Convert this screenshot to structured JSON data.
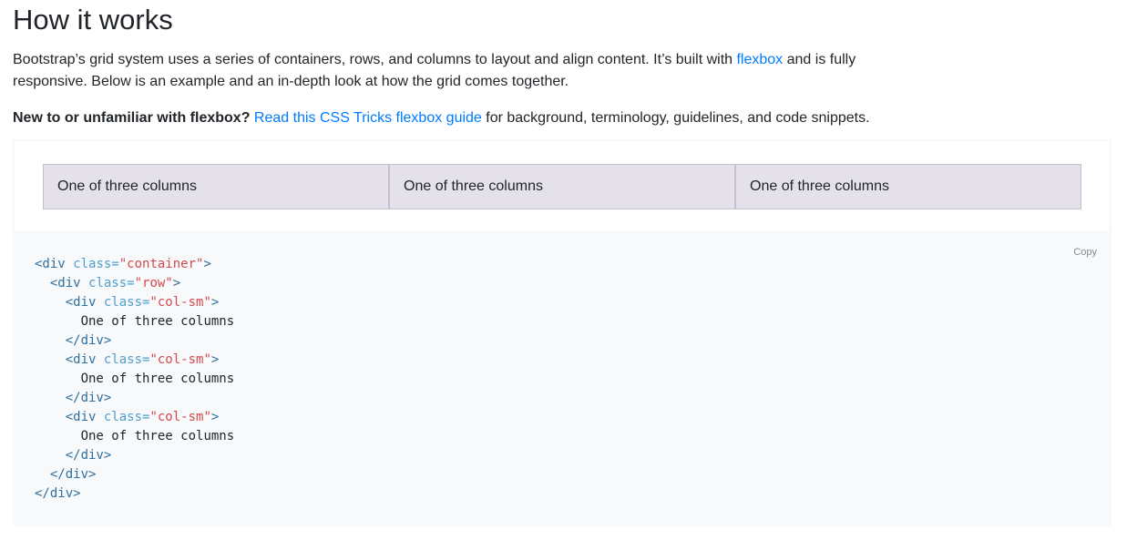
{
  "heading": "How it works",
  "intro": {
    "before_link": "Bootstrap’s grid system uses a series of containers, rows, and columns to layout and align content. It’s built with ",
    "link_text": "flexbox",
    "after_link": " and is fully responsive. Below is an example and an in-depth look at how the grid comes together."
  },
  "intro2": {
    "bold": "New to or unfamiliar with flexbox?",
    "link_text": "Read this CSS Tricks flexbox guide",
    "after_link": " for background, terminology, guidelines, and code snippets."
  },
  "example": {
    "columns": [
      "One of three columns",
      "One of three columns",
      "One of three columns"
    ]
  },
  "code": {
    "copy_label": "Copy",
    "lines": [
      {
        "indent": "",
        "parts": [
          {
            "t": "tag",
            "v": "<div"
          },
          {
            "t": "text",
            "v": " "
          },
          {
            "t": "attr",
            "v": "class="
          },
          {
            "t": "val",
            "v": "\"container\""
          },
          {
            "t": "tag",
            "v": ">"
          }
        ]
      },
      {
        "indent": "  ",
        "parts": [
          {
            "t": "tag",
            "v": "<div"
          },
          {
            "t": "text",
            "v": " "
          },
          {
            "t": "attr",
            "v": "class="
          },
          {
            "t": "val",
            "v": "\"row\""
          },
          {
            "t": "tag",
            "v": ">"
          }
        ]
      },
      {
        "indent": "    ",
        "parts": [
          {
            "t": "tag",
            "v": "<div"
          },
          {
            "t": "text",
            "v": " "
          },
          {
            "t": "attr",
            "v": "class="
          },
          {
            "t": "val",
            "v": "\"col-sm\""
          },
          {
            "t": "tag",
            "v": ">"
          }
        ]
      },
      {
        "indent": "      ",
        "parts": [
          {
            "t": "text",
            "v": "One of three columns"
          }
        ]
      },
      {
        "indent": "    ",
        "parts": [
          {
            "t": "tag",
            "v": "</div>"
          }
        ]
      },
      {
        "indent": "    ",
        "parts": [
          {
            "t": "tag",
            "v": "<div"
          },
          {
            "t": "text",
            "v": " "
          },
          {
            "t": "attr",
            "v": "class="
          },
          {
            "t": "val",
            "v": "\"col-sm\""
          },
          {
            "t": "tag",
            "v": ">"
          }
        ]
      },
      {
        "indent": "      ",
        "parts": [
          {
            "t": "text",
            "v": "One of three columns"
          }
        ]
      },
      {
        "indent": "    ",
        "parts": [
          {
            "t": "tag",
            "v": "</div>"
          }
        ]
      },
      {
        "indent": "    ",
        "parts": [
          {
            "t": "tag",
            "v": "<div"
          },
          {
            "t": "text",
            "v": " "
          },
          {
            "t": "attr",
            "v": "class="
          },
          {
            "t": "val",
            "v": "\"col-sm\""
          },
          {
            "t": "tag",
            "v": ">"
          }
        ]
      },
      {
        "indent": "      ",
        "parts": [
          {
            "t": "text",
            "v": "One of three columns"
          }
        ]
      },
      {
        "indent": "    ",
        "parts": [
          {
            "t": "tag",
            "v": "</div>"
          }
        ]
      },
      {
        "indent": "  ",
        "parts": [
          {
            "t": "tag",
            "v": "</div>"
          }
        ]
      },
      {
        "indent": "",
        "parts": [
          {
            "t": "tag",
            "v": "</div>"
          }
        ]
      }
    ]
  },
  "colors": {
    "link": "#007bff",
    "column_bg": "#e5e1ea",
    "column_border": "#c6bfd0",
    "code_bg": "#f8f9fa",
    "code_tag": "#2f6f9f",
    "code_attr": "#4f9fcf",
    "code_value": "#d44950"
  }
}
